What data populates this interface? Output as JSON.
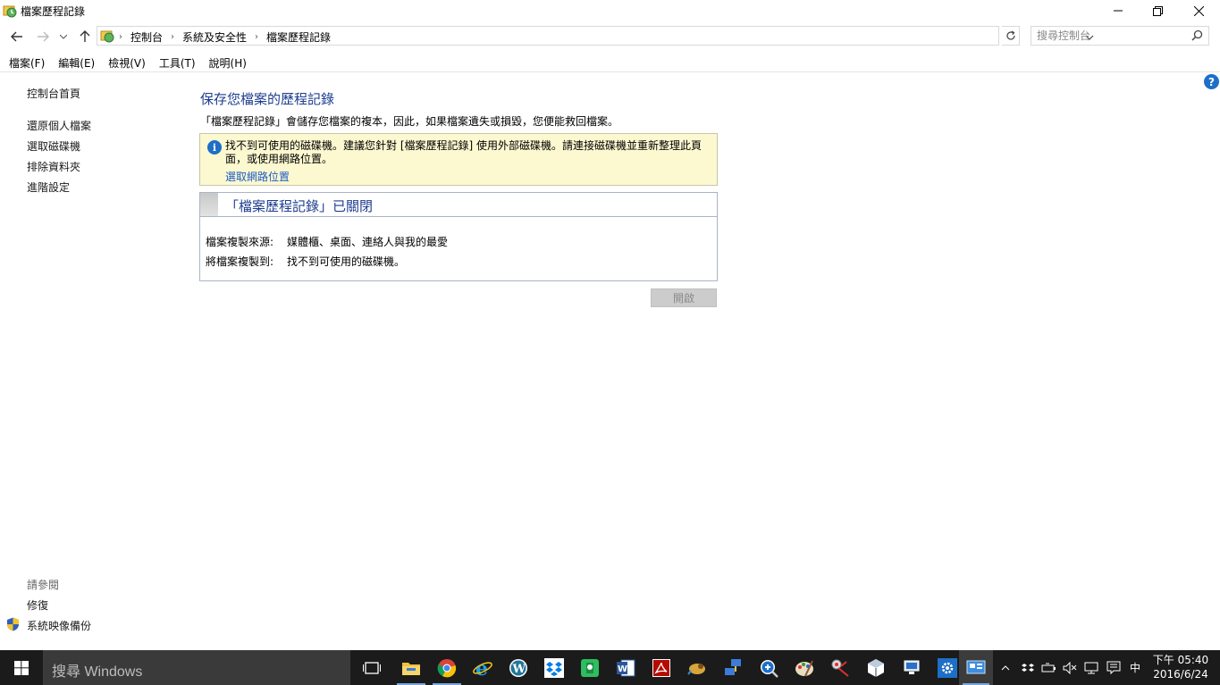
{
  "window": {
    "title": "檔案歷程記錄"
  },
  "address": {
    "crumbs": [
      "控制台",
      "系統及安全性",
      "檔案歷程記錄"
    ]
  },
  "search": {
    "placeholder": "搜尋控制台"
  },
  "menu": {
    "items": [
      "檔案(F)",
      "編輯(E)",
      "檢視(V)",
      "工具(T)",
      "說明(H)"
    ]
  },
  "sidebar": {
    "home": "控制台首頁",
    "links": [
      "還原個人檔案",
      "選取磁碟機",
      "排除資料夾",
      "進階設定"
    ],
    "see_also_title": "請參閱",
    "see_also": [
      "修復",
      "系統映像備份"
    ]
  },
  "main": {
    "title": "保存您檔案的歷程記錄",
    "description": "「檔案歷程記錄」會儲存您檔案的複本，因此，如果檔案遺失或損毀，您便能救回檔案。",
    "info": {
      "text": "找不到可使用的磁碟機。建議您針對 [檔案歷程記錄] 使用外部磁碟機。請連接磁碟機並重新整理此頁面，或使用網路位置。",
      "link": "選取網路位置"
    },
    "status": {
      "heading": "「檔案歷程記錄」已關閉",
      "source_label": "檔案複製來源:",
      "source_value": "媒體櫃、桌面、連絡人與我的最愛",
      "target_label": "將檔案複製到:",
      "target_value": "找不到可使用的磁碟機。"
    },
    "enable_button": "開啟"
  },
  "taskbar": {
    "search_placeholder": "搜尋 Windows",
    "apps": [
      "task-view",
      "file-explorer",
      "chrome",
      "internet-explorer",
      "wordpress",
      "dropbox",
      "evernote",
      "word",
      "acrobat",
      "app-bird",
      "network-app",
      "magnifier",
      "paint",
      "snipping",
      "virtualbox",
      "remote",
      "settings",
      "control-panel"
    ],
    "ime": "中",
    "time": "下午 05:40",
    "date": "2016/6/24"
  },
  "colors": {
    "accent": "#1e3d8f",
    "link": "#1d5bc7",
    "info_bg": "#fcf8d0",
    "taskbar_bg": "#1b1b1b"
  }
}
